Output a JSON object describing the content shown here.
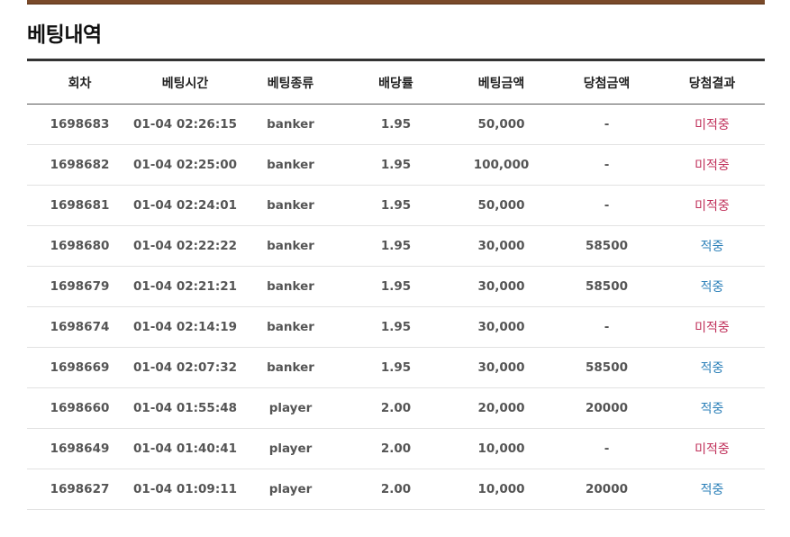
{
  "page": {
    "title": "베팅내역"
  },
  "colors": {
    "top_bar": "#7a4a2a",
    "win": "#2a7fb8",
    "lose": "#c0305a"
  },
  "table": {
    "headers": [
      "회차",
      "베팅시간",
      "베팅종류",
      "배당률",
      "베팅금액",
      "당첨금액",
      "당첨결과"
    ],
    "rows": [
      {
        "round": "1698683",
        "time": "01-04 02:26:15",
        "type": "banker",
        "odds": "1.95",
        "bet": "50,000",
        "win_amount": "-",
        "result": "미적중",
        "status": "lose"
      },
      {
        "round": "1698682",
        "time": "01-04 02:25:00",
        "type": "banker",
        "odds": "1.95",
        "bet": "100,000",
        "win_amount": "-",
        "result": "미적중",
        "status": "lose"
      },
      {
        "round": "1698681",
        "time": "01-04 02:24:01",
        "type": "banker",
        "odds": "1.95",
        "bet": "50,000",
        "win_amount": "-",
        "result": "미적중",
        "status": "lose"
      },
      {
        "round": "1698680",
        "time": "01-04 02:22:22",
        "type": "banker",
        "odds": "1.95",
        "bet": "30,000",
        "win_amount": "58500",
        "result": "적중",
        "status": "win"
      },
      {
        "round": "1698679",
        "time": "01-04 02:21:21",
        "type": "banker",
        "odds": "1.95",
        "bet": "30,000",
        "win_amount": "58500",
        "result": "적중",
        "status": "win"
      },
      {
        "round": "1698674",
        "time": "01-04 02:14:19",
        "type": "banker",
        "odds": "1.95",
        "bet": "30,000",
        "win_amount": "-",
        "result": "미적중",
        "status": "lose"
      },
      {
        "round": "1698669",
        "time": "01-04 02:07:32",
        "type": "banker",
        "odds": "1.95",
        "bet": "30,000",
        "win_amount": "58500",
        "result": "적중",
        "status": "win"
      },
      {
        "round": "1698660",
        "time": "01-04 01:55:48",
        "type": "player",
        "odds": "2.00",
        "bet": "20,000",
        "win_amount": "20000",
        "result": "적중",
        "status": "win"
      },
      {
        "round": "1698649",
        "time": "01-04 01:40:41",
        "type": "player",
        "odds": "2.00",
        "bet": "10,000",
        "win_amount": "-",
        "result": "미적중",
        "status": "lose"
      },
      {
        "round": "1698627",
        "time": "01-04 01:09:11",
        "type": "player",
        "odds": "2.00",
        "bet": "10,000",
        "win_amount": "20000",
        "result": "적중",
        "status": "win"
      }
    ]
  }
}
